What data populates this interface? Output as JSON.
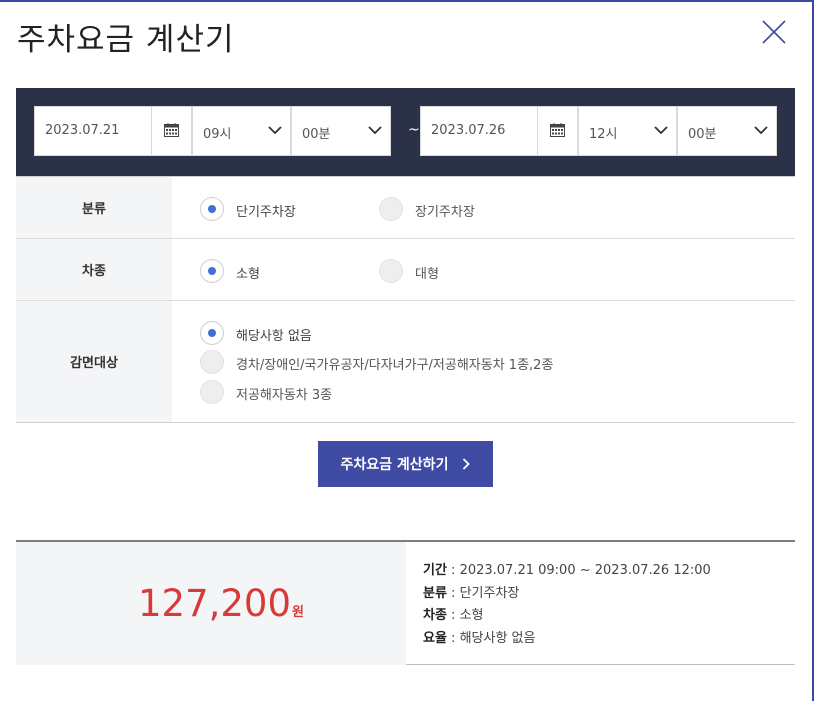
{
  "title": "주차요금 계산기",
  "period": {
    "start_date": "2023.07.21",
    "start_hour": "09시",
    "start_min": "00분",
    "separator": "~",
    "end_date": "2023.07.26",
    "end_hour": "12시",
    "end_min": "00분"
  },
  "category": {
    "label": "분류",
    "options": [
      "단기주차장",
      "장기주차장"
    ],
    "selected": "단기주차장"
  },
  "car_type": {
    "label": "차종",
    "options": [
      "소형",
      "대형"
    ],
    "selected": "소형"
  },
  "discount": {
    "label": "감면대상",
    "options": [
      "해당사항 없음",
      "경차/장애인/국가유공자/다자녀가구/저공해자동차 1종,2종",
      "저공해자동차 3종"
    ],
    "selected": "해당사항 없음"
  },
  "calc_button": "주차요금 계산하기",
  "result": {
    "amount": "127,200",
    "unit": "원",
    "period_label": "기간",
    "period_value": " : 2023.07.21 09:00 ~ 2023.07.26 12:00",
    "category_label": "분류",
    "category_value": " : 단기주차장",
    "car_label": "차종",
    "car_value": " : 소형",
    "rate_label": "요율",
    "rate_value": " : 해당사항 없음"
  },
  "colors": {
    "accent": "#3f4aa3",
    "radio_selected": "#3f6fd9",
    "amount": "#d63b38",
    "datebar": "#2b3146"
  },
  "icons": [
    "close-icon",
    "calendar-icon",
    "chevron-down-icon",
    "chevron-right-icon"
  ]
}
